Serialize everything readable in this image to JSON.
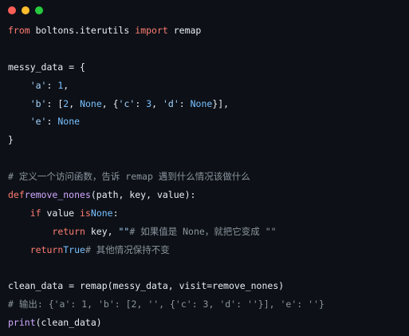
{
  "colors": {
    "background": "#0d1117",
    "text": "#e6edf3",
    "keyword": "#ff7b72",
    "string": "#a5d6ff",
    "number": "#79c0ff",
    "constant": "#79c0ff",
    "function": "#d2a8ff",
    "comment": "#8b949e",
    "dot_red": "#ff5f56",
    "dot_yellow": "#ffbd2e",
    "dot_green": "#27c93f"
  },
  "window_controls": [
    "close-dot",
    "minimize-dot",
    "maximize-dot"
  ],
  "code_lines": [
    [
      [
        "kw",
        "from"
      ],
      [
        "plain",
        " boltons.iterutils "
      ],
      [
        "kw",
        "import"
      ],
      [
        "plain",
        " remap"
      ]
    ],
    [],
    [
      [
        "plain",
        "messy_data = {"
      ]
    ],
    [
      [
        "plain",
        "    "
      ],
      [
        "str",
        "'a'"
      ],
      [
        "plain",
        ": "
      ],
      [
        "num",
        "1"
      ],
      [
        "plain",
        ","
      ]
    ],
    [
      [
        "plain",
        "    "
      ],
      [
        "str",
        "'b'"
      ],
      [
        "plain",
        ": ["
      ],
      [
        "num",
        "2"
      ],
      [
        "plain",
        ", "
      ],
      [
        "const",
        "None"
      ],
      [
        "plain",
        ", {"
      ],
      [
        "str",
        "'c'"
      ],
      [
        "plain",
        ": "
      ],
      [
        "num",
        "3"
      ],
      [
        "plain",
        ", "
      ],
      [
        "str",
        "'d'"
      ],
      [
        "plain",
        ": "
      ],
      [
        "const",
        "None"
      ],
      [
        "plain",
        "}],"
      ]
    ],
    [
      [
        "plain",
        "    "
      ],
      [
        "str",
        "'e'"
      ],
      [
        "plain",
        ": "
      ],
      [
        "const",
        "None"
      ]
    ],
    [
      [
        "plain",
        "}"
      ]
    ],
    [],
    [
      [
        "cm",
        "# 定义一个访问函数，告诉 remap 遇到什么情况该做什么"
      ]
    ],
    [
      [
        "kw",
        "def"
      ],
      [
        "fn",
        "remove_nones"
      ],
      [
        "plain",
        "(path, key, value):"
      ]
    ],
    [
      [
        "plain",
        "    "
      ],
      [
        "kw",
        "if"
      ],
      [
        "plain",
        " value "
      ],
      [
        "kw",
        "is"
      ],
      [
        "const",
        "None"
      ],
      [
        "plain",
        ":"
      ]
    ],
    [
      [
        "plain",
        "        "
      ],
      [
        "kw",
        "return"
      ],
      [
        "plain",
        " key, "
      ],
      [
        "str",
        "\"\""
      ],
      [
        "cm",
        "# 如果值是 None，就把它变成 \"\""
      ]
    ],
    [
      [
        "plain",
        "    "
      ],
      [
        "kw",
        "return"
      ],
      [
        "const",
        "True"
      ],
      [
        "cm",
        "# 其他情况保持不变"
      ]
    ],
    [],
    [
      [
        "plain",
        "clean_data = remap(messy_data, visit=remove_nones)"
      ]
    ],
    [
      [
        "cm",
        "# 输出: {'a': 1, 'b': [2, '', {'c': 3, 'd': ''}], 'e': ''}"
      ]
    ],
    [
      [
        "fn",
        "print"
      ],
      [
        "plain",
        "(clean_data)"
      ]
    ]
  ]
}
